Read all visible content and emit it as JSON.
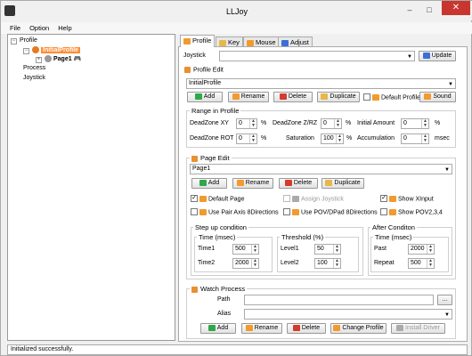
{
  "window": {
    "title": "LLJoy",
    "minimize": "–",
    "maximize": "□",
    "close": "✕"
  },
  "menu": [
    "File",
    "Option",
    "Help"
  ],
  "tree": {
    "root": "Profile",
    "profile": "InitialProfile",
    "page": "Page1",
    "process": "Process",
    "joystick": "Joystick"
  },
  "tabs": [
    "Profile",
    "Key",
    "Mouse",
    "Adjust"
  ],
  "joystick": {
    "label": "Joystick",
    "value": "",
    "update": "Update"
  },
  "profile_edit": {
    "title": "Profile Edit",
    "value": "InitialProfile",
    "add": "Add",
    "rename": "Rename",
    "delete": "Delete",
    "duplicate": "Duplicate",
    "default_profile": "Default Profile",
    "sound": "Sound"
  },
  "range": {
    "title": "Range in Profile",
    "deadzone_xy": "DeadZone XY",
    "deadzone_xy_val": "0",
    "deadzone_zrz": "DeadZone Z/RZ",
    "deadzone_zrz_val": "0",
    "initial_amount": "Initial Amount",
    "initial_amount_val": "0",
    "deadzone_rot": "DeadZone ROT",
    "deadzone_rot_val": "0",
    "saturation": "Saturation",
    "saturation_val": "100",
    "accumulation": "Accumulation",
    "accumulation_val": "0",
    "pct": "%",
    "msec": "msec"
  },
  "page_edit": {
    "title": "Page Edit",
    "value": "Page1",
    "add": "Add",
    "rename": "Rename",
    "delete": "Delete",
    "duplicate": "Duplicate",
    "default_page": "Default Page",
    "assign_joystick": "Assign Joystick",
    "show_xinput": "Show XInput",
    "use_pair_axis": "Use Pair Axis 8Directions",
    "use_pov": "Use POV/DPad 8Directions",
    "show_pov": "Show POV2,3,4"
  },
  "step_up": {
    "title": "Step up condition",
    "time_title": "Time (msec)",
    "time1": "Time1",
    "time1_val": "500",
    "time2": "Time2",
    "time2_val": "2000",
    "threshold_title": "Threshold (%)",
    "level1": "Level1",
    "level1_val": "50",
    "level2": "Level2",
    "level2_val": "100"
  },
  "after": {
    "title": "After Conditon",
    "time_title": "Time (msec)",
    "past": "Past",
    "past_val": "2000",
    "repeat": "Repeat",
    "repeat_val": "500"
  },
  "watch": {
    "title": "Watch Process",
    "path": "Path",
    "alias": "Alias",
    "browse": "...",
    "add": "Add",
    "rename": "Rename",
    "delete": "Delete",
    "change_profile": "Change Profile",
    "install_driver": "Install Driver"
  },
  "status": "Initialized successfully."
}
